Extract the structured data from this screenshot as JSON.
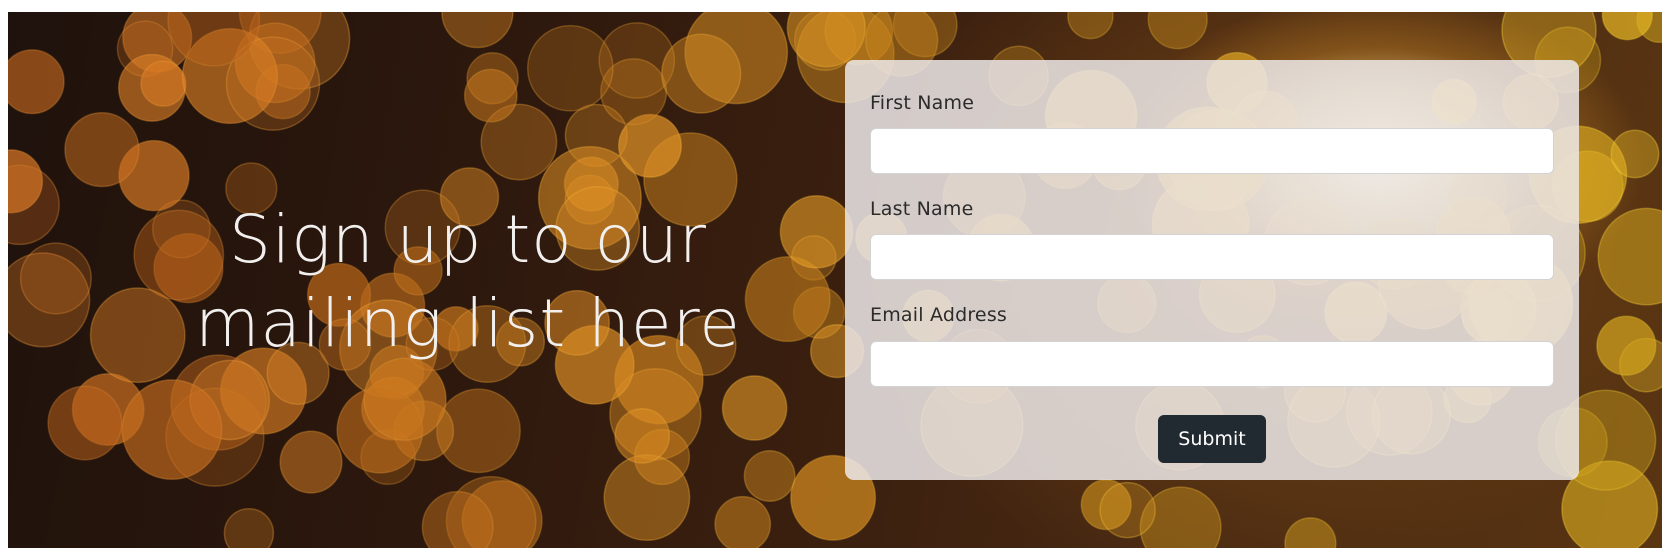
{
  "headline": {
    "line1": "Sign up to our",
    "line2": "mailing list here"
  },
  "form": {
    "first_name_label": "First Name",
    "first_name_value": "",
    "last_name_label": "Last Name",
    "last_name_value": "",
    "email_label": "Email Address",
    "email_value": "",
    "submit_label": "Submit"
  },
  "colors": {
    "button_background": "#222a31",
    "button_text": "#ffffff",
    "headline_text": "#f2f0ee",
    "bokeh_warm": "#d4761f",
    "bokeh_gold": "#f0b84a"
  },
  "background": {
    "image_description_icon": "bokeh-lights-image"
  }
}
